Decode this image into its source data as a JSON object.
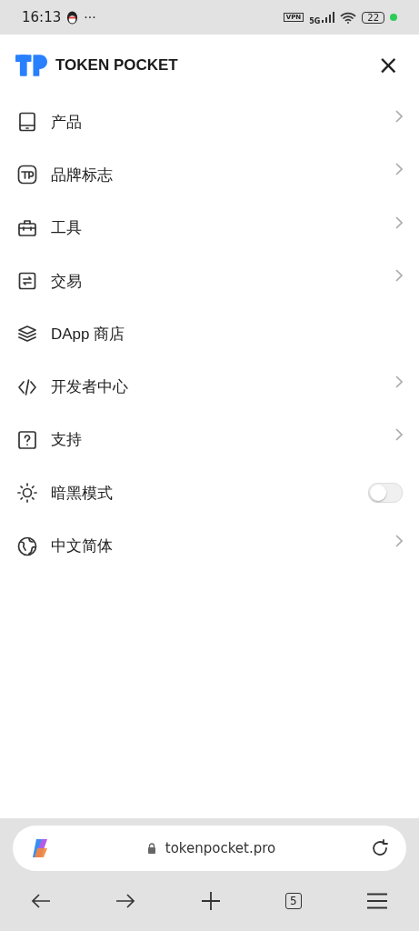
{
  "status_bar": {
    "time": "16:13",
    "more": "···",
    "vpn": "VPN",
    "network": "5G",
    "battery": "22"
  },
  "header": {
    "brand": "TOKEN POCKET",
    "close": "×"
  },
  "menu": [
    {
      "label": "产品",
      "kind": "link"
    },
    {
      "label": "品牌标志",
      "kind": "link"
    },
    {
      "label": "工具",
      "kind": "link"
    },
    {
      "label": "交易",
      "kind": "link"
    },
    {
      "label": "DApp 商店",
      "kind": "plain"
    },
    {
      "label": "开发者中心",
      "kind": "link"
    },
    {
      "label": "支持",
      "kind": "link"
    },
    {
      "label": "暗黑模式",
      "kind": "toggle",
      "on": false
    },
    {
      "label": "中文简体",
      "kind": "link"
    }
  ],
  "browser": {
    "url": "tokenpocket.pro",
    "tabs_count": "5"
  }
}
